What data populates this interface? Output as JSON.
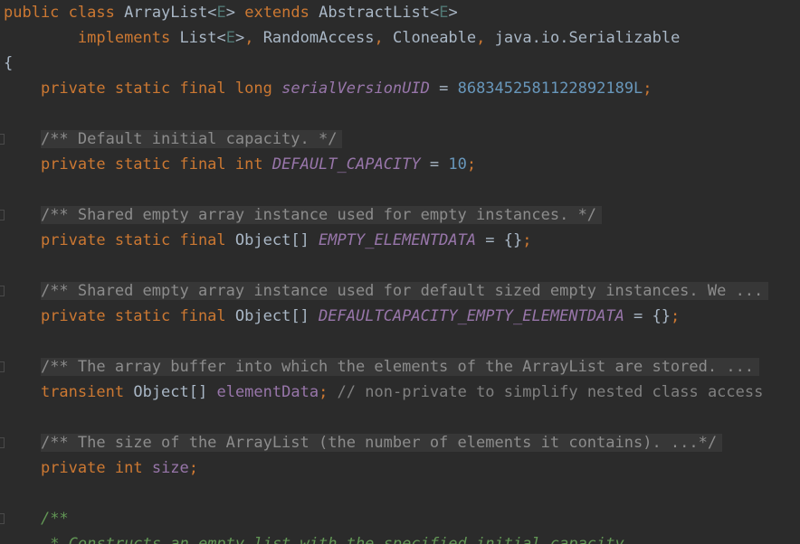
{
  "code": {
    "class_decl": {
      "kw_public": "public",
      "kw_class": "class",
      "class_name": "ArrayList<",
      "generic_e": "E",
      "close_gt": ">",
      "kw_extends": "extends",
      "super_name": "AbstractList<",
      "generic_e2": "E",
      "close_gt2": ">"
    },
    "implements_line": {
      "kw_implements": "implements",
      "list_name": "List<",
      "generic_e": "E",
      "close_gt": ">",
      "comma1": ",",
      "random_access": "RandomAccess",
      "comma2": ",",
      "cloneable": "Cloneable",
      "comma3": ",",
      "serializable": "java.io.Serializable"
    },
    "open_brace": "{",
    "serial_line": {
      "modifiers": "private static final",
      "type": "long",
      "name": "serialVersionUID",
      "eq": " = ",
      "value": "8683452581122892189L",
      "semi": ";"
    },
    "doc1": "/** Default initial capacity. */",
    "default_capacity_line": {
      "modifiers": "private static final",
      "type": "int",
      "name": "DEFAULT_CAPACITY",
      "eq": " = ",
      "value": "10",
      "semi": ";"
    },
    "doc2": "/** Shared empty array instance used for empty instances. */",
    "empty_elementdata_line": {
      "modifiers": "private static final",
      "type": "Object[]",
      "name": "EMPTY_ELEMENTDATA",
      "rest": " = {}",
      "semi": ";"
    },
    "doc3": "/** Shared empty array instance used for default sized empty instances. We ...",
    "default_empty_line": {
      "modifiers": "private static final",
      "type": "Object[]",
      "name": "DEFAULTCAPACITY_EMPTY_ELEMENTDATA",
      "rest": " = {}",
      "semi": ";"
    },
    "doc4": "/** The array buffer into which the elements of the ArrayList are stored. ...",
    "element_data_line": {
      "modifier": "transient",
      "type": "Object[]",
      "name": "elementData",
      "semi": ";",
      "comment": " // non-private to simplify nested class access"
    },
    "doc5": "/** The size of the ArrayList (the number of elements it contains). ...*/",
    "size_line": {
      "modifier": "private",
      "type": "int",
      "name": "size",
      "semi": ";"
    },
    "doc6_open": "/**",
    "doc6_line2": " * Constructs an empty list with the specified initial capacity."
  },
  "colors": {
    "background": "#2b2b2b",
    "keyword": "#cc7832",
    "field": "#9876aa",
    "number": "#6897bb",
    "doc_comment": "#629755",
    "comment": "#808080",
    "text": "#a9b7c6"
  }
}
